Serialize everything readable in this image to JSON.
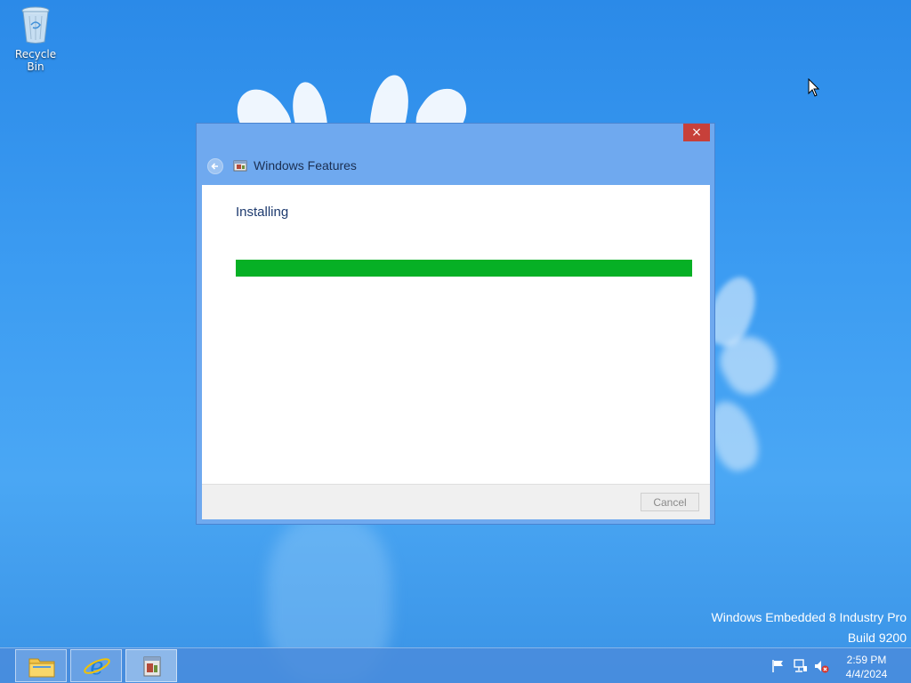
{
  "desktop": {
    "icons": [
      {
        "label": "Recycle Bin",
        "icon": "recycle-bin-icon"
      }
    ],
    "watermark": {
      "line1": "Windows Embedded 8 Industry Pro",
      "line2": "Build 9200"
    }
  },
  "dialog": {
    "title": "Windows Features",
    "close_label": "×",
    "status": "Installing",
    "progress": 1.0,
    "cancel_label": "Cancel",
    "colors": {
      "progress": "#06b025",
      "close": "#c7403a",
      "frame": "#6fa9ef"
    }
  },
  "taskbar": {
    "buttons": [
      {
        "name": "file-explorer",
        "icon": "folder-icon",
        "active": false
      },
      {
        "name": "internet-explorer",
        "icon": "ie-icon",
        "active": false
      },
      {
        "name": "windows-features",
        "icon": "windows-features-icon",
        "active": true
      }
    ],
    "tray": [
      "action-center-flag-icon",
      "network-icon",
      "volume-muted-icon"
    ],
    "clock": {
      "time": "2:59 PM",
      "date": "4/4/2024"
    }
  }
}
